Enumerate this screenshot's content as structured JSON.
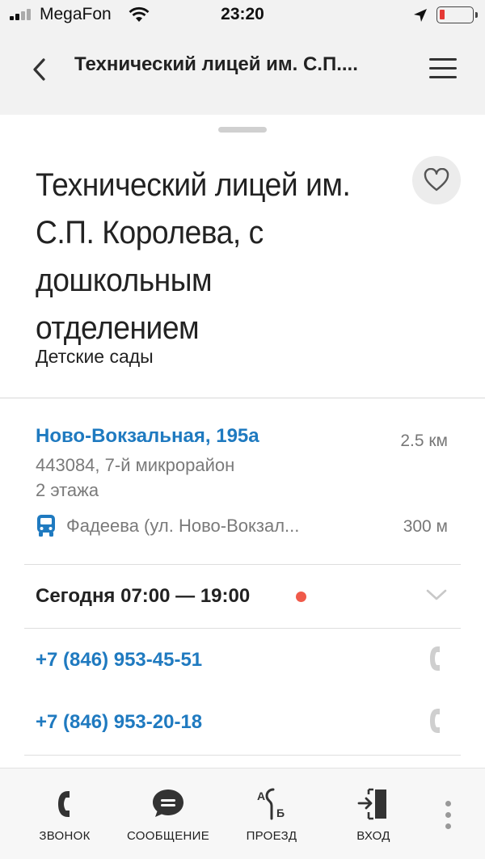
{
  "status_bar": {
    "carrier": "MegaFon",
    "time": "23:20",
    "battery_level": 0.15
  },
  "nav": {
    "title": "Технический лицей им. С.П...."
  },
  "place": {
    "title": "Технический лицей им. С.П. Королева, с дошкольным отделением",
    "category": "Детские сады",
    "address": "Ново-Вокзальная, 195а",
    "distance": "2.5 км",
    "address_line2": "443084, 7-й микрорайон",
    "address_line3": "2 этажа",
    "stop_name": "Фадеева (ул. Ново-Вокзал...",
    "stop_distance": "300 м",
    "hours": "Сегодня 07:00 — 19:00",
    "hours_status_color": "#f05a4a",
    "phones": [
      "+7 (846) 953-45-51",
      "+7 (846) 953-20-18"
    ]
  },
  "colors": {
    "link": "#1f7ac0",
    "accent_red": "#f05a4a"
  },
  "bottom_bar": {
    "actions": [
      {
        "label": "ЗВОНОК",
        "icon": "phone-icon"
      },
      {
        "label": "СООБЩЕНИЕ",
        "icon": "chat-bubble-icon"
      },
      {
        "label": "ПРОЕЗД",
        "icon": "route-icon"
      },
      {
        "label": "ВХОД",
        "icon": "entrance-icon"
      }
    ],
    "more_icon": "more-vertical-icon"
  }
}
